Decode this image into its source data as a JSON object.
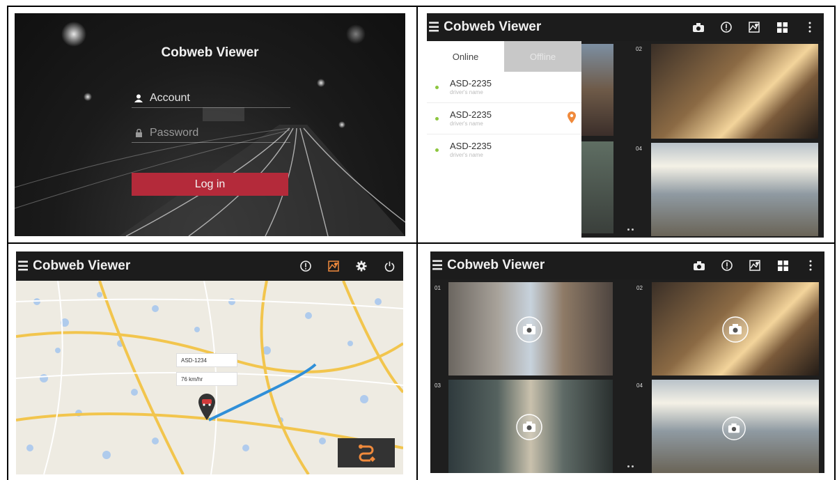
{
  "login": {
    "title": "Cobweb Viewer",
    "account_placeholder": "Account",
    "password_placeholder": "Password",
    "login_button": "Log in"
  },
  "app": {
    "title": "Cobweb Viewer",
    "menu_glyph": "☰"
  },
  "device_list": {
    "tabs": [
      {
        "label": "Online",
        "active": true
      },
      {
        "label": "Offline",
        "active": false
      }
    ],
    "devices": [
      {
        "id": "ASD-2235",
        "driver": "driver's name",
        "status": "online"
      },
      {
        "id": "ASD-2235",
        "driver": "driver's name",
        "status": "online",
        "located": true
      },
      {
        "id": "ASD-2235",
        "driver": "driver's name",
        "status": "online"
      }
    ],
    "cams": [
      {
        "number": "02"
      },
      {
        "number": "04"
      }
    ]
  },
  "map": {
    "vehicle_id": "ASD-1234",
    "speed": "76 km/hr",
    "route_color": "#2f8fd8"
  },
  "quad": {
    "cams": [
      {
        "number": "01"
      },
      {
        "number": "02"
      },
      {
        "number": "03"
      },
      {
        "number": "04"
      }
    ]
  },
  "colors": {
    "accent": "#b42a3a",
    "active_orange": "#f08a3c",
    "online_dot": "#8dc63f",
    "appbar": "#1c1c1c"
  }
}
